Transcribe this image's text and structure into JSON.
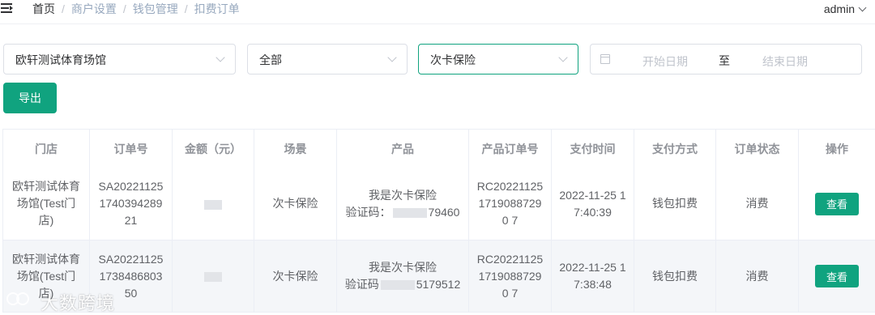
{
  "header": {
    "breadcrumb": [
      "首页",
      "商户设置",
      "钱包管理",
      "扣费订单"
    ],
    "user": "admin"
  },
  "filters": {
    "store": "欧轩测试体育场馆",
    "scene": "全部",
    "product": "次卡保险",
    "date_start_placeholder": "开始日期",
    "date_separator": "至",
    "date_end_placeholder": "结束日期"
  },
  "actions": {
    "export_label": "导出"
  },
  "table": {
    "columns": [
      "门店",
      "订单号",
      "金额（元）",
      "场景",
      "产品",
      "产品订单号",
      "支付时间",
      "支付方式",
      "订单状态",
      "操作"
    ],
    "rows": [
      {
        "store": "欧轩测试体育场馆(Test门店)",
        "order_no": "SA20221125174039428921",
        "scene": "次卡保险",
        "product_name": "我是次卡保险",
        "verify_prefix": "验证码：",
        "verify_suffix": "79460",
        "product_order_no": "RC2022112517190887290 7",
        "pay_time": "2022-11-25 17:40:39",
        "pay_method": "钱包扣费",
        "status": "消费",
        "action": "查看"
      },
      {
        "store": "欧轩测试体育场馆(Test门店)",
        "order_no": "SA20221125173848680350",
        "scene": "次卡保险",
        "product_name": "我是次卡保险",
        "verify_prefix": "验证码",
        "verify_suffix": "5179512",
        "product_order_no": "RC2022112517190887290 7",
        "pay_time": "2022-11-25 17:38:48",
        "pay_method": "钱包扣费",
        "status": "消费",
        "action": "查看"
      }
    ]
  },
  "watermark": {
    "text": "大数跨境"
  },
  "colors": {
    "accent": "#10a37f",
    "header_text": "#909399",
    "row_stripe": "#f4f6f9"
  }
}
